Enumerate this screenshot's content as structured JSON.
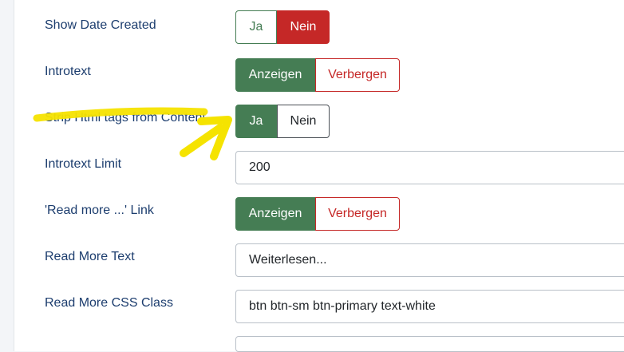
{
  "rows": [
    {
      "label": "Show Date Created",
      "type": "toggle",
      "options": [
        "Ja",
        "Nein"
      ],
      "selected": "Nein"
    },
    {
      "label": "Introtext",
      "type": "toggle",
      "options": [
        "Anzeigen",
        "Verbergen"
      ],
      "selected": "Anzeigen"
    },
    {
      "label": "Strip Html tags from Content",
      "type": "toggle",
      "options": [
        "Ja",
        "Nein"
      ],
      "selected": "Ja"
    },
    {
      "label": "Introtext Limit",
      "type": "input",
      "value": "200"
    },
    {
      "label": "'Read more ...' Link",
      "type": "toggle",
      "options": [
        "Anzeigen",
        "Verbergen"
      ],
      "selected": "Anzeigen"
    },
    {
      "label": "Read More Text",
      "type": "input",
      "value": "Weiterlesen..."
    },
    {
      "label": "Read More CSS Class",
      "type": "input",
      "value": "btn btn-sm btn-primary text-white"
    }
  ],
  "colors": {
    "accent_green": "#457d54",
    "accent_red": "#c52827",
    "label_blue": "#1c3d6e",
    "highlight_yellow": "#f5e300"
  }
}
